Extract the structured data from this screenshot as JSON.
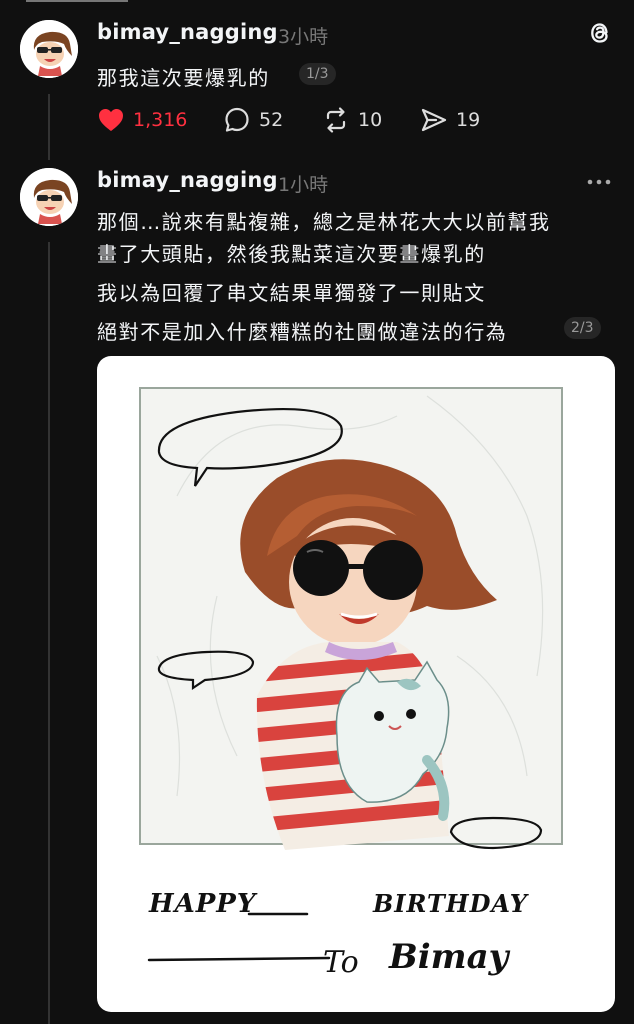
{
  "post1": {
    "username": "bimay_nagging",
    "time": "3小時",
    "text": "那我這次要爆乳的",
    "pager": "1/3",
    "likes": "1,316",
    "comments": "52",
    "reposts": "10",
    "shares": "19",
    "colors": {
      "like": "#ff3040"
    }
  },
  "post2": {
    "username": "bimay_nagging",
    "time": "1小時",
    "lines": [
      "那個…說來有點複雜，總之是林花大大以前幫我",
      "畫了大頭貼，然後我點菜這次要畫爆乳的",
      "我以為回覆了串文結果單獨發了一則貼文",
      "絕對不是加入什麼糟糕的社團做違法的行為"
    ],
    "pager": "2/3",
    "image_caption": {
      "happy": "HAPPY",
      "birthday": "BIRTHDAY",
      "to": "To",
      "name": "Bimay"
    }
  }
}
